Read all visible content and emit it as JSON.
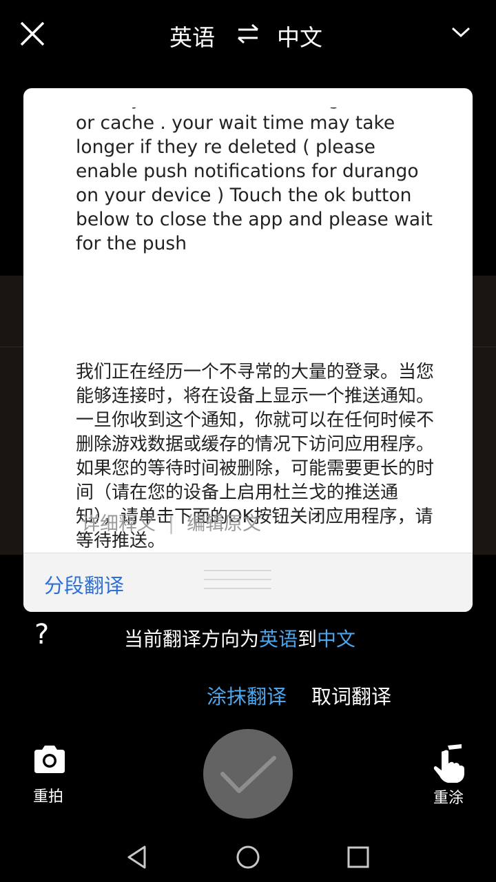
{
  "header": {
    "source_lang": "英语",
    "target_lang": "中文",
    "icons": [
      "close-icon",
      "swap-icon",
      "chevron-down-icon"
    ]
  },
  "card": {
    "source_text": "could you choose to delete game data or cache . your wait time may take longer if they re deleted ( please enable push notifications for durango on your device ) Touch the ok button below to close the app and please wait for the push",
    "translated_text": "我们正在经历一个不寻常的大量的登录。当您能够连接时，将在设备上显示一个推送通知。一旦你收到这个通知，你就可以在任何时候不删除游戏数据或缓存的情况下访问应用程序。如果您的等待时间被删除，可能需要更长的时间（请在您的设备上启用杜兰戈的推送通知），请单击下面的OK按钮关闭应用程序，请等待推送。",
    "detail_link": "详细释义",
    "separator": "|",
    "edit_link": "编辑原文",
    "segment_button": "分段翻译"
  },
  "help_symbol": "?",
  "direction": {
    "prefix": "当前翻译方向为",
    "from": "英语",
    "middle": "到",
    "to": "中文"
  },
  "modes": {
    "smear": "涂抹翻译",
    "word": "取词翻译",
    "active": "smear"
  },
  "bottom": {
    "retake_label": "重拍",
    "repaint_label": "重涂",
    "icons": [
      "camera-icon",
      "checkmark-icon",
      "hand-pointer-icon"
    ]
  },
  "colors": {
    "accent": "#4ea5ea",
    "link_blue": "#2d6fd8",
    "confirm_bg": "#636363"
  }
}
